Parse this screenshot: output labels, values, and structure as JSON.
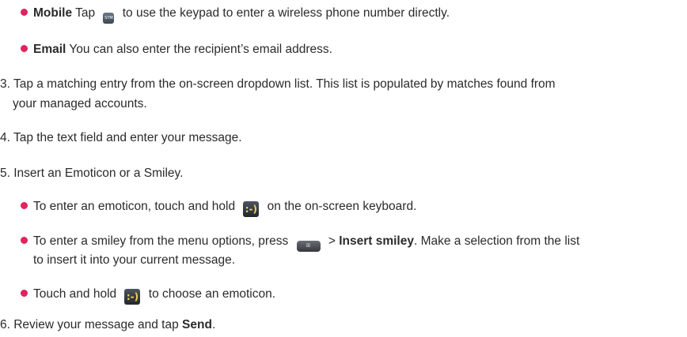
{
  "items": {
    "mobile": {
      "term": "Mobile",
      "before": " Tap ",
      "icon_text": "SYM",
      "after": " to use the keypad to enter a wireless phone number directly."
    },
    "email": {
      "term": "Email",
      "text": " You can also enter the recipient’s email address."
    },
    "step3": {
      "line1": "3. Tap a matching entry from the on-screen dropdown list. This list is populated by matches found from",
      "line2": "your managed accounts."
    },
    "step4": "4. Tap the text field and enter your message.",
    "step5": "5. Insert an Emoticon or a Smiley.",
    "emoticon_hold": {
      "before": "To enter an emoticon, touch and hold ",
      "icon_text": ":-)",
      "after": " on the on-screen keyboard."
    },
    "smiley_menu": {
      "before": "To enter a smiley from the menu options, press ",
      "icon_text": "⊞",
      "gt": " > ",
      "bold": "Insert smiley",
      "after": ". Make a selection from the list",
      "line2": "to insert it into your current message."
    },
    "touch_hold": {
      "before": "Touch and hold ",
      "icon_text": ":-)",
      "after": " to choose an emoticon."
    },
    "step6": {
      "before": "6. Review your message and tap ",
      "bold": "Send",
      "after": "."
    }
  },
  "colors": {
    "bullet": "#e0245e",
    "text": "#2b2b2b"
  }
}
